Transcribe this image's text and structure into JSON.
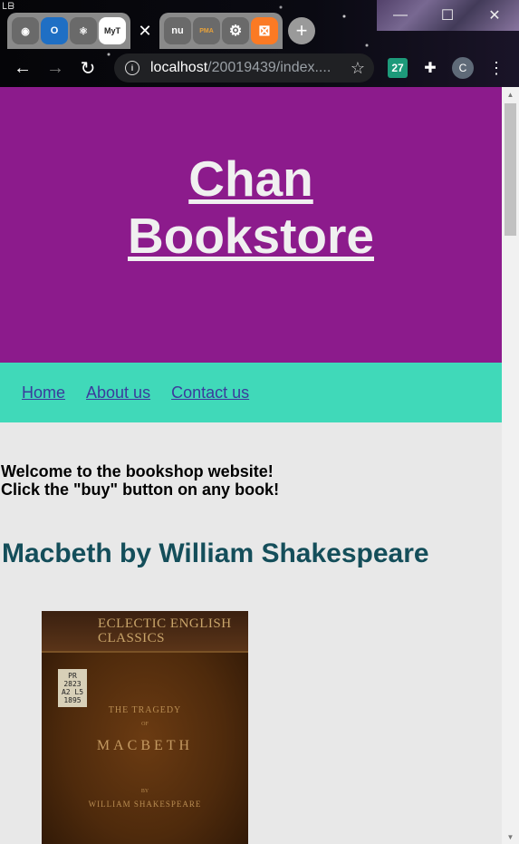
{
  "browser": {
    "profile_badge": "ᒪᗷ",
    "tabs": [
      {
        "icon": "globe-icon",
        "glyph": "◉"
      },
      {
        "icon": "outlook-icon",
        "glyph": "O"
      },
      {
        "icon": "react-icon",
        "glyph": "⚛"
      },
      {
        "icon": "myt-icon",
        "glyph": "MyT"
      },
      {
        "icon": "close-tab-icon",
        "glyph": "✕"
      },
      {
        "icon": "nu-icon",
        "glyph": "nu"
      },
      {
        "icon": "phpmyadmin-icon",
        "glyph": "PMA"
      },
      {
        "icon": "settings-icon",
        "glyph": "⚙"
      },
      {
        "icon": "xampp-icon",
        "glyph": "⊠"
      }
    ],
    "new_tab": "+",
    "window_controls": {
      "minimize": "—",
      "maximize": "☐",
      "close": "✕"
    },
    "nav": {
      "back": "←",
      "forward": "→",
      "reload": "↻"
    },
    "url_host": "localhost",
    "url_path": "/20019439/index....",
    "extensions": [
      {
        "name": "ext-27",
        "label": "27",
        "color": "#1d9a7a"
      },
      {
        "name": "extensions-icon",
        "label": "✚",
        "color": "transparent"
      },
      {
        "name": "profile-avatar",
        "label": "C",
        "color": "#5f6a78"
      },
      {
        "name": "menu-icon",
        "label": "⋮",
        "color": "transparent"
      }
    ]
  },
  "page": {
    "header": {
      "title_line1": "Chan",
      "title_line2": "Bookstore"
    },
    "nav": [
      "Home",
      "About us",
      "Contact us"
    ],
    "welcome_line1": "Welcome to the bookshop website!",
    "welcome_line2": "Click the \"buy\" button on any book!",
    "book": {
      "heading": "Macbeth by William Shakespeare",
      "cover": {
        "series": "ECLECTIC ENGLISH CLASSICS",
        "label": "PR 2823 A2 L5 1895",
        "the": "THE TRAGEDY",
        "of": "OF",
        "name": "MACBETH",
        "by": "BY",
        "author": "WILLIAM SHAKESPEARE"
      }
    }
  },
  "colors": {
    "header_bg": "#8c1b8c",
    "nav_bg": "#40d9b9",
    "page_bg": "#e8e8e8",
    "heading": "#144e5a",
    "link": "#3b3b9c"
  }
}
